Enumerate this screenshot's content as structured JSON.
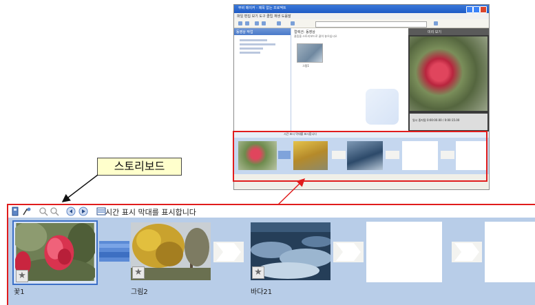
{
  "callout": {
    "text": "스토리보드"
  },
  "mini_screenshot": {
    "title": "무비 메이커 - 제목 없는 프로젝트",
    "menu": "파일  편집  보기  도구  클립  재생  도움말",
    "left_pane_title": "동영상 작업",
    "mid_title": "컬렉션: 동영상",
    "mid_subtitle": "클립을 스토리보드로 끌어 놓으십시오",
    "mid_thumb_label": "그림1",
    "preview_title": "미리 보기",
    "preview_ctrl": "일시 중지됨    0:00:00.00 / 0:00:15.00",
    "storyboard_tools": "시간 표시 막대를 표시합니다"
  },
  "storyboard": {
    "toolbar_text": "시간 표시 막대를 표시합니다",
    "clips": [
      {
        "label": "꽃1"
      },
      {
        "label": "그림2"
      },
      {
        "label": "바다21"
      }
    ]
  },
  "icons": {
    "favorite": "star-icon",
    "transition": "arrow-right-icon"
  },
  "colors": {
    "highlight": "#e01c1c",
    "storyboard_bg": "#b8cde8",
    "callout_bg": "#ffffcc"
  }
}
